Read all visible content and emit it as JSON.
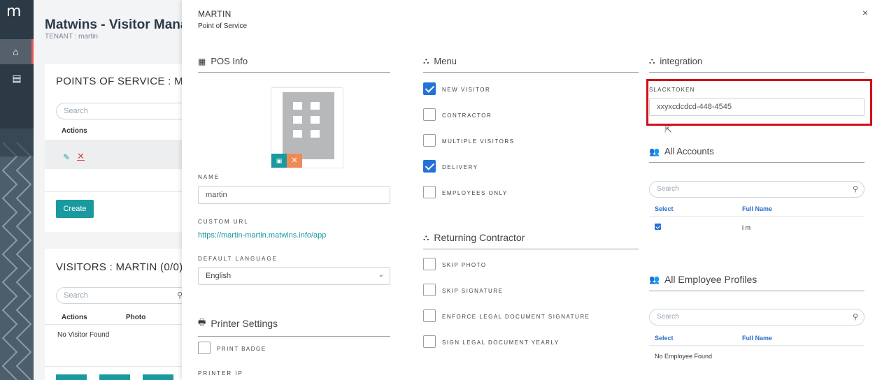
{
  "app": {
    "logo": "m",
    "title": "Matwins - Visitor Mana",
    "tenant": "TENANT : martin"
  },
  "rail": {
    "home_icon": "home-icon",
    "doc_icon": "document-icon"
  },
  "pos_card": {
    "title": "POINTS OF SERVICE : MA",
    "search_placeholder": "Search",
    "col_actions": "Actions",
    "create_label": "Create"
  },
  "visitors_card": {
    "title": "VISITORS : MARTIN (0/0)",
    "search_placeholder": "Search",
    "col_actions": "Actions",
    "col_photo": "Photo",
    "empty": "No Visitor Found"
  },
  "modal": {
    "title": "MARTIN",
    "subtitle": "Point of Service",
    "close": "×",
    "pos_info": {
      "heading": "POS Info",
      "name_label": "NAME",
      "name_value": "martin",
      "custom_url_label": "CUSTOM URL",
      "custom_url": "https://martin-martin.matwins.info/app",
      "language_label": "DEFAULT LANGUAGE",
      "language_value": "English"
    },
    "printer": {
      "heading": "Printer Settings",
      "print_badge": "PRINT BADGE",
      "printer_ip_label": "PRINTER IP"
    },
    "menu": {
      "heading": "Menu",
      "items": [
        {
          "label": "NEW VISITOR",
          "checked": true
        },
        {
          "label": "CONTRACTOR",
          "checked": false
        },
        {
          "label": "MULTIPLE VISITORS",
          "checked": false
        },
        {
          "label": "DELIVERY",
          "checked": true
        },
        {
          "label": "EMPLOYEES ONLY",
          "checked": false
        }
      ]
    },
    "returning": {
      "heading": "Returning Contractor",
      "items": [
        {
          "label": "SKIP PHOTO",
          "checked": false
        },
        {
          "label": "SKIP SIGNATURE",
          "checked": false
        },
        {
          "label": "ENFORCE LEGAL DOCUMENT SIGNATURE",
          "checked": false
        },
        {
          "label": "SIGN LEGAL DOCUMENT YEARLY",
          "checked": false
        }
      ]
    },
    "integration": {
      "heading": "integration",
      "slack_label": "SLACKTOKEN",
      "slack_value": "xxyxcdcdcd-448-4545"
    },
    "accounts": {
      "heading": "All Accounts",
      "search_placeholder": "Search",
      "col_select": "Select",
      "col_fullname": "Full Name",
      "rows": [
        {
          "checked": true,
          "name": "l m"
        }
      ]
    },
    "employees": {
      "heading": "All Employee Profiles",
      "search_placeholder": "Search",
      "col_select": "Select",
      "col_fullname": "Full Name",
      "empty": "No Employee Found"
    }
  },
  "colors": {
    "accent": "#1a9aa0",
    "highlight": "#d0101a",
    "checkbox": "#2372d6",
    "rail": "#2c3a45"
  }
}
